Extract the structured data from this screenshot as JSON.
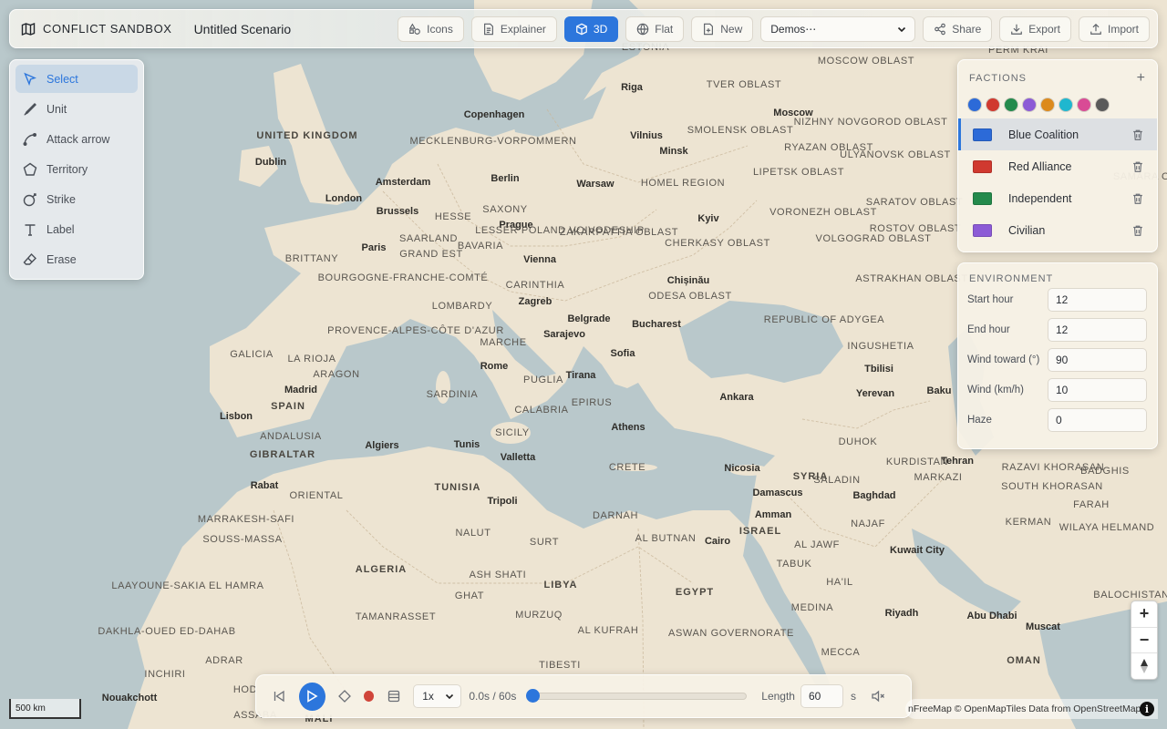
{
  "app": {
    "brand": "CONFLICT SANDBOX",
    "scenario_title": "Untitled Scenario"
  },
  "toolbar": {
    "icons_label": "Icons",
    "explainer_label": "Explainer",
    "view_3d_label": "3D",
    "flat_label": "Flat",
    "new_label": "New",
    "demos_value": "Demos⋯",
    "share_label": "Share",
    "export_label": "Export",
    "import_label": "Import"
  },
  "tools": {
    "items": [
      {
        "label": "Select",
        "icon": "cursor-icon"
      },
      {
        "label": "Unit",
        "icon": "unit-icon"
      },
      {
        "label": "Attack arrow",
        "icon": "attack-arrow-icon"
      },
      {
        "label": "Territory",
        "icon": "pentagon-icon"
      },
      {
        "label": "Strike",
        "icon": "strike-icon"
      },
      {
        "label": "Label",
        "icon": "text-icon"
      },
      {
        "label": "Erase",
        "icon": "eraser-icon"
      }
    ],
    "active": "Select"
  },
  "factions": {
    "title": "FACTIONS",
    "add_icon": "plus-icon",
    "swatches": [
      "#2c6ad8",
      "#d0392f",
      "#248a4c",
      "#8c5bd6",
      "#dc8a1c",
      "#1fb7cf",
      "#d94b95",
      "#5a5a5a"
    ],
    "items": [
      {
        "name": "Blue Coalition",
        "color": "#2c6ad8"
      },
      {
        "name": "Red Alliance",
        "color": "#d0392f"
      },
      {
        "name": "Independent",
        "color": "#248a4c"
      },
      {
        "name": "Civilian",
        "color": "#8c5bd6"
      }
    ],
    "active": "Blue Coalition"
  },
  "environment": {
    "title": "ENVIRONMENT",
    "fields": [
      {
        "label": "Start hour",
        "value": "12"
      },
      {
        "label": "End hour",
        "value": "12"
      },
      {
        "label": "Wind toward (°)",
        "value": "90"
      },
      {
        "label": "Wind (km/h)",
        "value": "10"
      },
      {
        "label": "Haze",
        "value": "0"
      }
    ]
  },
  "timeline": {
    "speed": "1x",
    "time_readout": "0.0s / 60s",
    "progress": 0,
    "length_label": "Length",
    "length_value": "60",
    "length_unit": "s"
  },
  "map": {
    "zoom_in": "+",
    "zoom_out": "−",
    "scale_label": "500 km",
    "attribution": "nFreeMap © OpenMapTiles Data from OpenStreetMap",
    "attribution_info": "i",
    "labels": [
      {
        "text": "UNITED KINGDOM",
        "kind": "country"
      },
      {
        "text": "Dublin",
        "kind": "city"
      },
      {
        "text": "London",
        "kind": "city"
      },
      {
        "text": "Amsterdam",
        "kind": "city"
      },
      {
        "text": "Brussels",
        "kind": "city"
      },
      {
        "text": "Paris",
        "kind": "city"
      },
      {
        "text": "BRITTANY",
        "kind": "region"
      },
      {
        "text": "Copenhagen",
        "kind": "city"
      },
      {
        "text": "Riga",
        "kind": "city"
      },
      {
        "text": "Vilnius",
        "kind": "city"
      },
      {
        "text": "Minsk",
        "kind": "city"
      },
      {
        "text": "Moscow",
        "kind": "city"
      },
      {
        "text": "MECKLENBURG-VORPOMMERN",
        "kind": "region"
      },
      {
        "text": "Berlin",
        "kind": "city"
      },
      {
        "text": "Warsaw",
        "kind": "city"
      },
      {
        "text": "Kyiv",
        "kind": "city"
      },
      {
        "text": "HESSE",
        "kind": "region"
      },
      {
        "text": "SAXONY",
        "kind": "region"
      },
      {
        "text": "Prague",
        "kind": "city"
      },
      {
        "text": "LESSER POLAND VOIVODESHIP",
        "kind": "region"
      },
      {
        "text": "SAARLAND",
        "kind": "region"
      },
      {
        "text": "BAVARIA",
        "kind": "region"
      },
      {
        "text": "GRAND EST",
        "kind": "region"
      },
      {
        "text": "Vienna",
        "kind": "city"
      },
      {
        "text": "ZAKARPATTIA OBLAST",
        "kind": "region"
      },
      {
        "text": "CHERKASY OBLAST",
        "kind": "region"
      },
      {
        "text": "BOURGOGNE-FRANCHE-COMTÉ",
        "kind": "region"
      },
      {
        "text": "CARINTHIA",
        "kind": "region"
      },
      {
        "text": "Chișinău",
        "kind": "city"
      },
      {
        "text": "ODESA OBLAST",
        "kind": "region"
      },
      {
        "text": "Zagreb",
        "kind": "city"
      },
      {
        "text": "LOMBARDY",
        "kind": "region"
      },
      {
        "text": "PROVENCE-ALPES-CÔTE D'AZUR",
        "kind": "region"
      },
      {
        "text": "Belgrade",
        "kind": "city"
      },
      {
        "text": "Bucharest",
        "kind": "city"
      },
      {
        "text": "Sarajevo",
        "kind": "city"
      },
      {
        "text": "MARCHE",
        "kind": "region"
      },
      {
        "text": "Sofia",
        "kind": "city"
      },
      {
        "text": "GALICIA",
        "kind": "region"
      },
      {
        "text": "LA RIOJA",
        "kind": "region"
      },
      {
        "text": "ARAGON",
        "kind": "region"
      },
      {
        "text": "Rome",
        "kind": "city"
      },
      {
        "text": "PUGLIA",
        "kind": "region"
      },
      {
        "text": "Tirana",
        "kind": "city"
      },
      {
        "text": "Madrid",
        "kind": "city"
      },
      {
        "text": "SPAIN",
        "kind": "country"
      },
      {
        "text": "SARDINIA",
        "kind": "region"
      },
      {
        "text": "EPIRUS",
        "kind": "region"
      },
      {
        "text": "Lisbon",
        "kind": "city"
      },
      {
        "text": "CALABRIA",
        "kind": "region"
      },
      {
        "text": "Athens",
        "kind": "city"
      },
      {
        "text": "ANDALUSIA",
        "kind": "region"
      },
      {
        "text": "SICILY",
        "kind": "region"
      },
      {
        "text": "Algiers",
        "kind": "city"
      },
      {
        "text": "Tunis",
        "kind": "city"
      },
      {
        "text": "GIBRALTAR",
        "kind": "country"
      },
      {
        "text": "Valletta",
        "kind": "city"
      },
      {
        "text": "Rabat",
        "kind": "city"
      },
      {
        "text": "CRETE",
        "kind": "region"
      },
      {
        "text": "TUNISIA",
        "kind": "country"
      },
      {
        "text": "ORIENTAL",
        "kind": "region"
      },
      {
        "text": "Tripoli",
        "kind": "city"
      },
      {
        "text": "MARRAKESH-SAFI",
        "kind": "region"
      },
      {
        "text": "SOUSS-MASSA",
        "kind": "region"
      },
      {
        "text": "NALUT",
        "kind": "region"
      },
      {
        "text": "SURT",
        "kind": "region"
      },
      {
        "text": "DARNAH",
        "kind": "region"
      },
      {
        "text": "AL BUTNAN",
        "kind": "region"
      },
      {
        "text": "ALGERIA",
        "kind": "country"
      },
      {
        "text": "ASH SHATI",
        "kind": "region"
      },
      {
        "text": "LIBYA",
        "kind": "country"
      },
      {
        "text": "GHAT",
        "kind": "region"
      },
      {
        "text": "MURZUQ",
        "kind": "region"
      },
      {
        "text": "EGYPT",
        "kind": "country"
      },
      {
        "text": "TAMANRASSET",
        "kind": "region"
      },
      {
        "text": "AL KUFRAH",
        "kind": "region"
      },
      {
        "text": "LAAYOUNE-SAKIA EL HAMRA",
        "kind": "region"
      },
      {
        "text": "DAKHLA-OUED ED-DAHAB",
        "kind": "region"
      },
      {
        "text": "ADRAR",
        "kind": "region"
      },
      {
        "text": "INCHIRI",
        "kind": "region"
      },
      {
        "text": "TIBESTI",
        "kind": "region"
      },
      {
        "text": "Nouakchott",
        "kind": "city"
      },
      {
        "text": "HOD",
        "kind": "region"
      },
      {
        "text": "ASSABA",
        "kind": "region"
      },
      {
        "text": "MALI",
        "kind": "country"
      },
      {
        "text": "Cairo",
        "kind": "city"
      },
      {
        "text": "ASWAN GOVERNORATE",
        "kind": "region"
      },
      {
        "text": "ISRAEL",
        "kind": "country"
      },
      {
        "text": "Amman",
        "kind": "city"
      },
      {
        "text": "Damascus",
        "kind": "city"
      },
      {
        "text": "Nicosia",
        "kind": "city"
      },
      {
        "text": "SYRIA",
        "kind": "country"
      },
      {
        "text": "Ankara",
        "kind": "city"
      },
      {
        "text": "Baghdad",
        "kind": "city"
      },
      {
        "text": "Tbilisi",
        "kind": "city"
      },
      {
        "text": "Yerevan",
        "kind": "city"
      },
      {
        "text": "Baku",
        "kind": "city"
      },
      {
        "text": "Tehran",
        "kind": "city"
      },
      {
        "text": "Kuwait City",
        "kind": "city"
      },
      {
        "text": "Riyadh",
        "kind": "city"
      },
      {
        "text": "Abu Dhabi",
        "kind": "city"
      },
      {
        "text": "Muscat",
        "kind": "city"
      },
      {
        "text": "OMAN",
        "kind": "country"
      },
      {
        "text": "MECCA",
        "kind": "region"
      },
      {
        "text": "MEDINA",
        "kind": "region"
      },
      {
        "text": "TABUK",
        "kind": "region"
      },
      {
        "text": "HA'IL",
        "kind": "region"
      },
      {
        "text": "AL JAWF",
        "kind": "region"
      },
      {
        "text": "NAJAF",
        "kind": "region"
      },
      {
        "text": "SALADIN",
        "kind": "region"
      },
      {
        "text": "DUHOK",
        "kind": "region"
      },
      {
        "text": "KURDISTAN",
        "kind": "region"
      },
      {
        "text": "MARKAZI",
        "kind": "region"
      },
      {
        "text": "RAZAVI KHORASAN",
        "kind": "region"
      },
      {
        "text": "SOUTH KHORASAN",
        "kind": "region"
      },
      {
        "text": "FARAH",
        "kind": "region"
      },
      {
        "text": "KERMAN",
        "kind": "region"
      },
      {
        "text": "BALOCHISTAN",
        "kind": "region"
      },
      {
        "text": "WILAYA HELMAND",
        "kind": "region"
      },
      {
        "text": "BADGHIS",
        "kind": "region"
      },
      {
        "text": "REPUBLIC OF ADYGEA",
        "kind": "region"
      },
      {
        "text": "INGUSHETIA",
        "kind": "region"
      },
      {
        "text": "ASTRAKHAN OBLAST",
        "kind": "region"
      },
      {
        "text": "ROSTOV OBLAST",
        "kind": "region"
      },
      {
        "text": "VOLGOGRAD OBLAST",
        "kind": "region"
      },
      {
        "text": "VORONEZH OBLAST",
        "kind": "region"
      },
      {
        "text": "SARATOV OBLAST",
        "kind": "region"
      },
      {
        "text": "LIPETSK OBLAST",
        "kind": "region"
      },
      {
        "text": "HOMEL REGION",
        "kind": "region"
      },
      {
        "text": "SMOLENSK OBLAST",
        "kind": "region"
      },
      {
        "text": "RYAZAN OBLAST",
        "kind": "region"
      },
      {
        "text": "ULYANOVSK OBLAST",
        "kind": "region"
      },
      {
        "text": "SAMARA O",
        "kind": "region"
      },
      {
        "text": "NIZHNY NOVGOROD OBLAST",
        "kind": "region"
      },
      {
        "text": "TVER OBLAST",
        "kind": "region"
      },
      {
        "text": "MOSCOW OBLAST",
        "kind": "region"
      },
      {
        "text": "PERM KRAI",
        "kind": "region"
      },
      {
        "text": "ESTONIA",
        "kind": "region"
      }
    ]
  }
}
